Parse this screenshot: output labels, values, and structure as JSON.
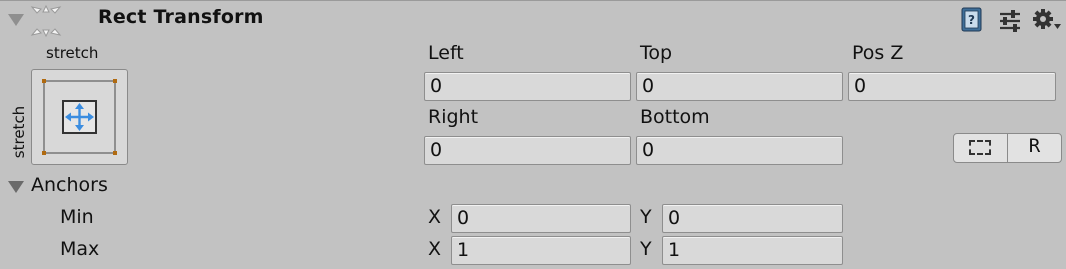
{
  "header": {
    "title": "Rect Transform",
    "icons": [
      "rect-transform-icon",
      "help-book-icon",
      "preset-sliders-icon",
      "gear-icon"
    ]
  },
  "anchor_preset": {
    "top_label": "stretch",
    "side_label": "stretch"
  },
  "fields": {
    "left": {
      "label": "Left",
      "value": "0"
    },
    "top": {
      "label": "Top",
      "value": "0"
    },
    "pos_z": {
      "label": "Pos Z",
      "value": "0"
    },
    "right": {
      "label": "Right",
      "value": "0"
    },
    "bottom": {
      "label": "Bottom",
      "value": "0"
    }
  },
  "mode_buttons": {
    "blueprint": "blueprint-mode-icon",
    "raw": "R"
  },
  "anchors": {
    "label": "Anchors",
    "min": {
      "label": "Min",
      "x_label": "X",
      "x": "0",
      "y_label": "Y",
      "y": "0"
    },
    "max": {
      "label": "Max",
      "x_label": "X",
      "x": "1",
      "y_label": "Y",
      "y": "1"
    }
  },
  "colors": {
    "background": "#c2c2c2",
    "field_bg": "#d9d9d9",
    "accent_blue": "#3b8de0",
    "anchor_orange": "#b06a10"
  }
}
